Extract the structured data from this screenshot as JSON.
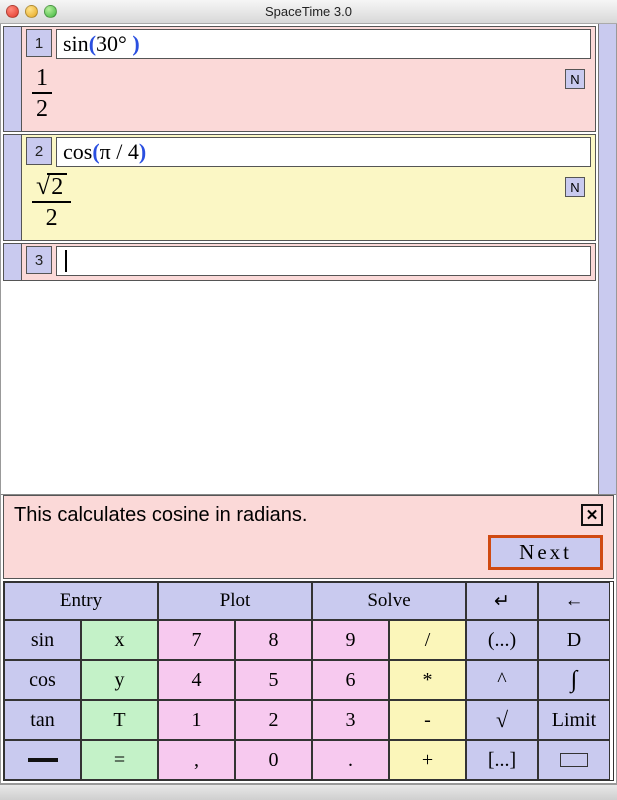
{
  "window": {
    "title": "SpaceTime 3.0"
  },
  "cells": [
    {
      "line": "1",
      "bg": "pink",
      "input_html": "sin<b class='paren'>(</b>30° <b class='paren'>)</b>",
      "result_type": "frac",
      "result": {
        "num": "1",
        "den": "2"
      },
      "badge": "N"
    },
    {
      "line": "2",
      "bg": "yellow",
      "input_html": "cos<b class='paren'>(</b>π / 4<b class='paren'>)</b>",
      "result_type": "sqrtfrac",
      "result": {
        "rad_arg": "2",
        "den": "2"
      },
      "badge": "N"
    },
    {
      "line": "3",
      "bg": "pink",
      "input_html": "",
      "result_type": "none"
    }
  ],
  "hint": {
    "text": "This calculates cosine in radians.",
    "next_label": "Next"
  },
  "keypad": {
    "header": [
      "Entry",
      "Plot",
      "Solve"
    ],
    "header_icons": [
      "return",
      "back"
    ],
    "rows": [
      [
        {
          "t": "sin",
          "c": "lav"
        },
        {
          "t": "x",
          "c": "grn"
        },
        {
          "t": "7",
          "c": "pnk"
        },
        {
          "t": "8",
          "c": "pnk"
        },
        {
          "t": "9",
          "c": "pnk"
        },
        {
          "t": "/",
          "c": "yel"
        },
        {
          "t": "(...)",
          "c": "lav"
        },
        {
          "t": "D",
          "c": "lav"
        }
      ],
      [
        {
          "t": "cos",
          "c": "lav"
        },
        {
          "t": "y",
          "c": "grn"
        },
        {
          "t": "4",
          "c": "pnk"
        },
        {
          "t": "5",
          "c": "pnk"
        },
        {
          "t": "6",
          "c": "pnk"
        },
        {
          "t": "*",
          "c": "yel"
        },
        {
          "t": "^",
          "c": "lav"
        },
        {
          "icon": "int",
          "c": "lav"
        }
      ],
      [
        {
          "t": "tan",
          "c": "lav"
        },
        {
          "t": "T",
          "c": "grn"
        },
        {
          "t": "1",
          "c": "pnk"
        },
        {
          "t": "2",
          "c": "pnk"
        },
        {
          "t": "3",
          "c": "pnk"
        },
        {
          "t": "-",
          "c": "yel"
        },
        {
          "icon": "sqrt",
          "c": "lav"
        },
        {
          "t": "Limit",
          "c": "lav"
        }
      ],
      [
        {
          "icon": "underline",
          "c": "lav"
        },
        {
          "t": "=",
          "c": "grn"
        },
        {
          "t": ",",
          "c": "pnk"
        },
        {
          "t": "0",
          "c": "pnk"
        },
        {
          "t": ".",
          "c": "pnk"
        },
        {
          "t": "+",
          "c": "yel"
        },
        {
          "t": "[...]",
          "c": "lav"
        },
        {
          "icon": "rect",
          "c": "lav"
        }
      ]
    ]
  }
}
